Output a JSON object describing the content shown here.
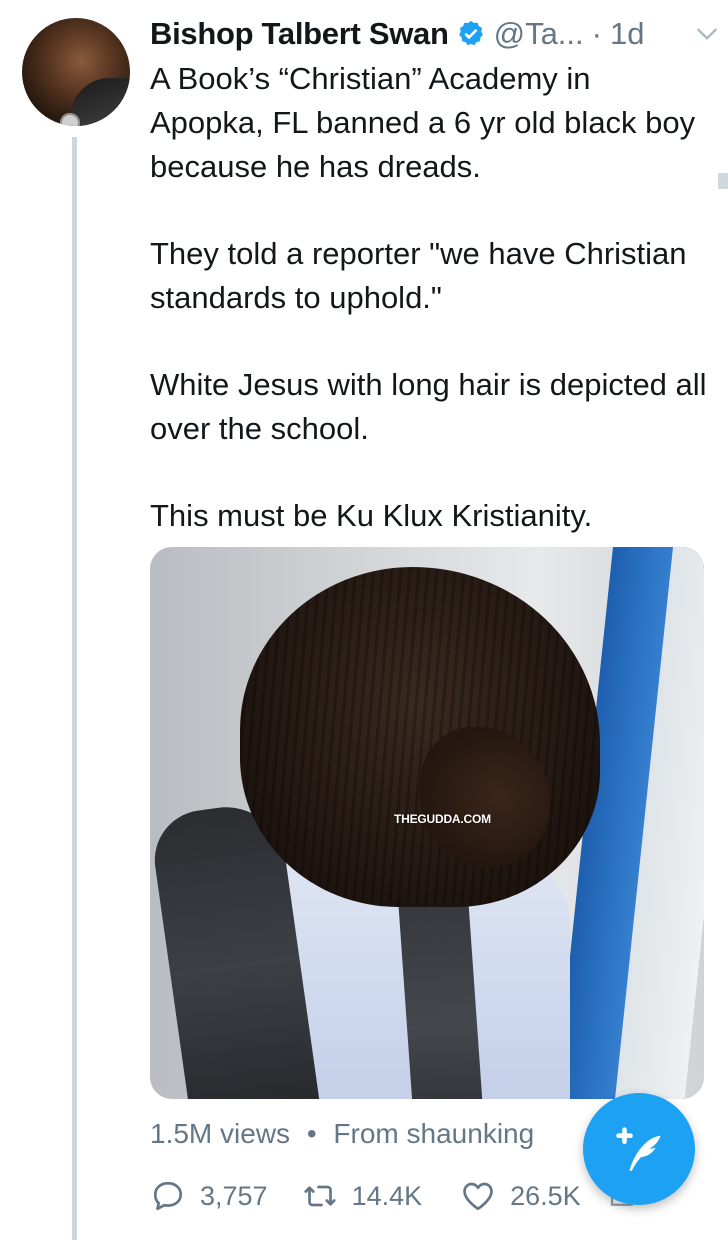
{
  "tweet": {
    "author_name": "Bishop Talbert Swan",
    "handle": "@Ta...",
    "separator_dot": "·",
    "timestamp": "1d",
    "verified": true,
    "paragraphs": [
      "A Book’s “Christian” Academy in Apopka, FL banned a 6 yr old black boy because he has dreads.",
      "They told a reporter \"we have Christian standards to uphold.\"",
      "White Jesus with long hair is depicted all over the school.",
      "This must be Ku Klux Kristianity."
    ],
    "media": {
      "watermark": "THEGUDDA.COM"
    },
    "views": "1.5M views",
    "meta_separator": "•",
    "attribution": "From shaunking",
    "counts": {
      "replies": "3,757",
      "retweets": "14.4K",
      "likes": "26.5K"
    }
  },
  "icons": {
    "verified": "verified-badge-icon",
    "menu": "chevron-down-icon",
    "reply": "reply-icon",
    "retweet": "retweet-icon",
    "like": "heart-icon",
    "share": "share-icon",
    "compose": "compose-tweet-icon"
  },
  "colors": {
    "accent": "#1da1f2",
    "secondary_text": "#657786",
    "primary_text": "#14171a",
    "thread_line": "#ccd6dd"
  }
}
